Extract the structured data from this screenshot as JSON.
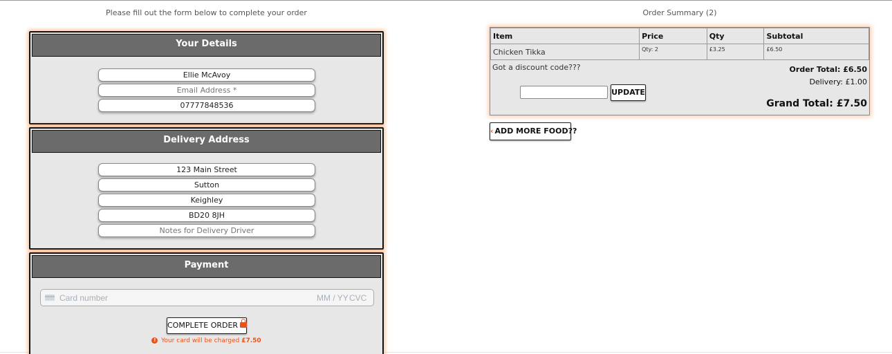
{
  "intro": "Please fill out the form below to complete your order",
  "details": {
    "title": "Your Details",
    "name": "Ellie McAvoy",
    "email_placeholder": "Email Address *",
    "phone": "07777848536"
  },
  "address": {
    "title": "Delivery Address",
    "line1": "123 Main Street",
    "line2": "Sutton",
    "town": "Keighley",
    "postcode": "BD20 8JH",
    "notes_placeholder": "Notes for Delivery Driver"
  },
  "payment": {
    "title": "Payment",
    "card_placeholder": "Card number",
    "expiry_placeholder": "MM / YY",
    "cvc_placeholder": "CVC",
    "complete_label": "COMPLETE ORDER",
    "warning_prefix": "Your card will be charged",
    "warning_amount": "£7.50"
  },
  "summary": {
    "title": "Order Summary (2)",
    "columns": [
      "Item",
      "Price",
      "Qty",
      "Subtotal"
    ],
    "rows": [
      {
        "item": "Chicken Tikka",
        "price": "Qty: 2",
        "qty": "£3.25",
        "subtotal": "£6.50"
      }
    ],
    "discount_label": "Got a discount code???",
    "update_label": "UPDATE",
    "order_total": "Order Total: £6.50",
    "delivery": "Delivery: £1.00",
    "grand_total": "Grand Total: £7.50"
  },
  "add_more_label": "ADD MORE FOOD??",
  "colors": {
    "accent": "#e8531c",
    "panel_header": "#6b6b6b",
    "panel_bg": "#e8e7e7"
  }
}
